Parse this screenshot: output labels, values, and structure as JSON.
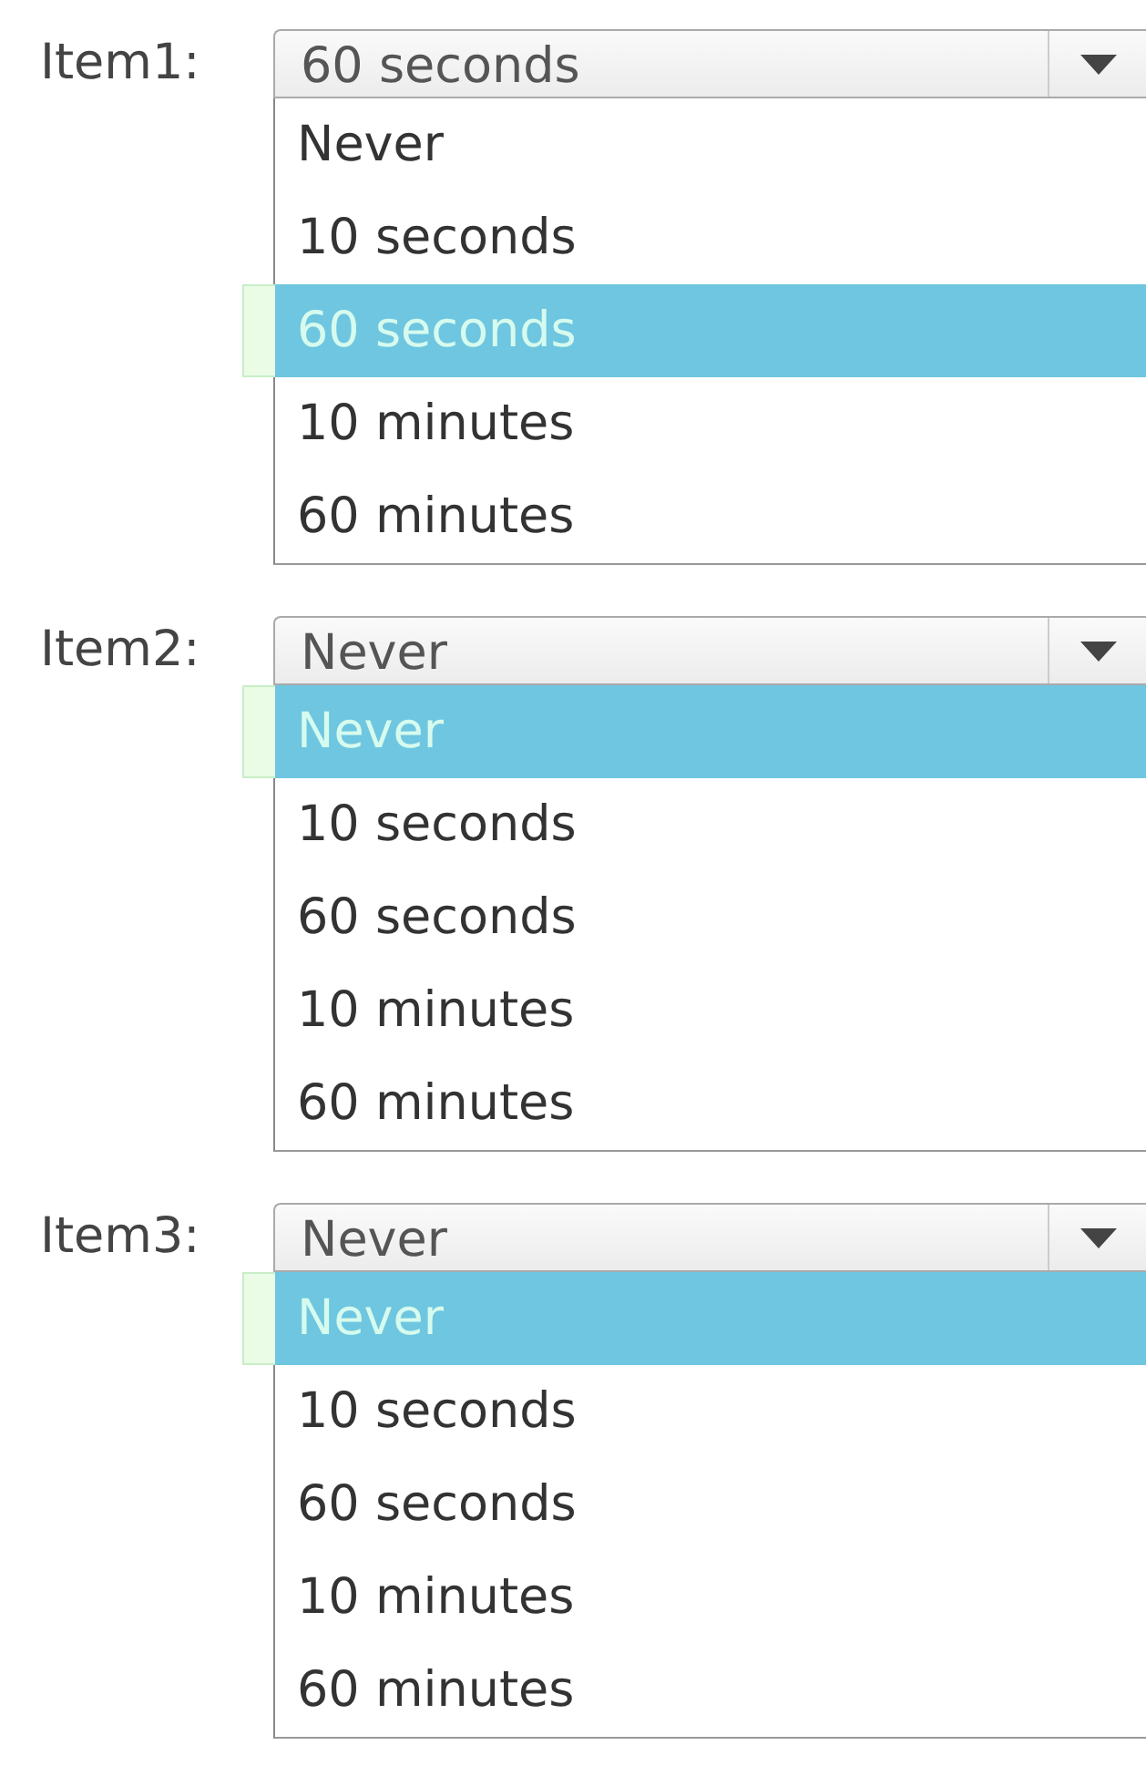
{
  "dropdowns": [
    {
      "label": "Item1:",
      "value": "60 seconds",
      "options": [
        {
          "text": "Never",
          "selected": false
        },
        {
          "text": "10 seconds",
          "selected": false
        },
        {
          "text": "60 seconds",
          "selected": true
        },
        {
          "text": "10 minutes",
          "selected": false
        },
        {
          "text": "60 minutes",
          "selected": false
        }
      ]
    },
    {
      "label": "Item2:",
      "value": "Never",
      "options": [
        {
          "text": "Never",
          "selected": true
        },
        {
          "text": "10 seconds",
          "selected": false
        },
        {
          "text": "60 seconds",
          "selected": false
        },
        {
          "text": "10 minutes",
          "selected": false
        },
        {
          "text": "60 minutes",
          "selected": false
        }
      ]
    },
    {
      "label": "Item3:",
      "value": "Never",
      "options": [
        {
          "text": "Never",
          "selected": true
        },
        {
          "text": "10 seconds",
          "selected": false
        },
        {
          "text": "60 seconds",
          "selected": false
        },
        {
          "text": "10 minutes",
          "selected": false
        },
        {
          "text": "60 minutes",
          "selected": false
        }
      ]
    }
  ]
}
